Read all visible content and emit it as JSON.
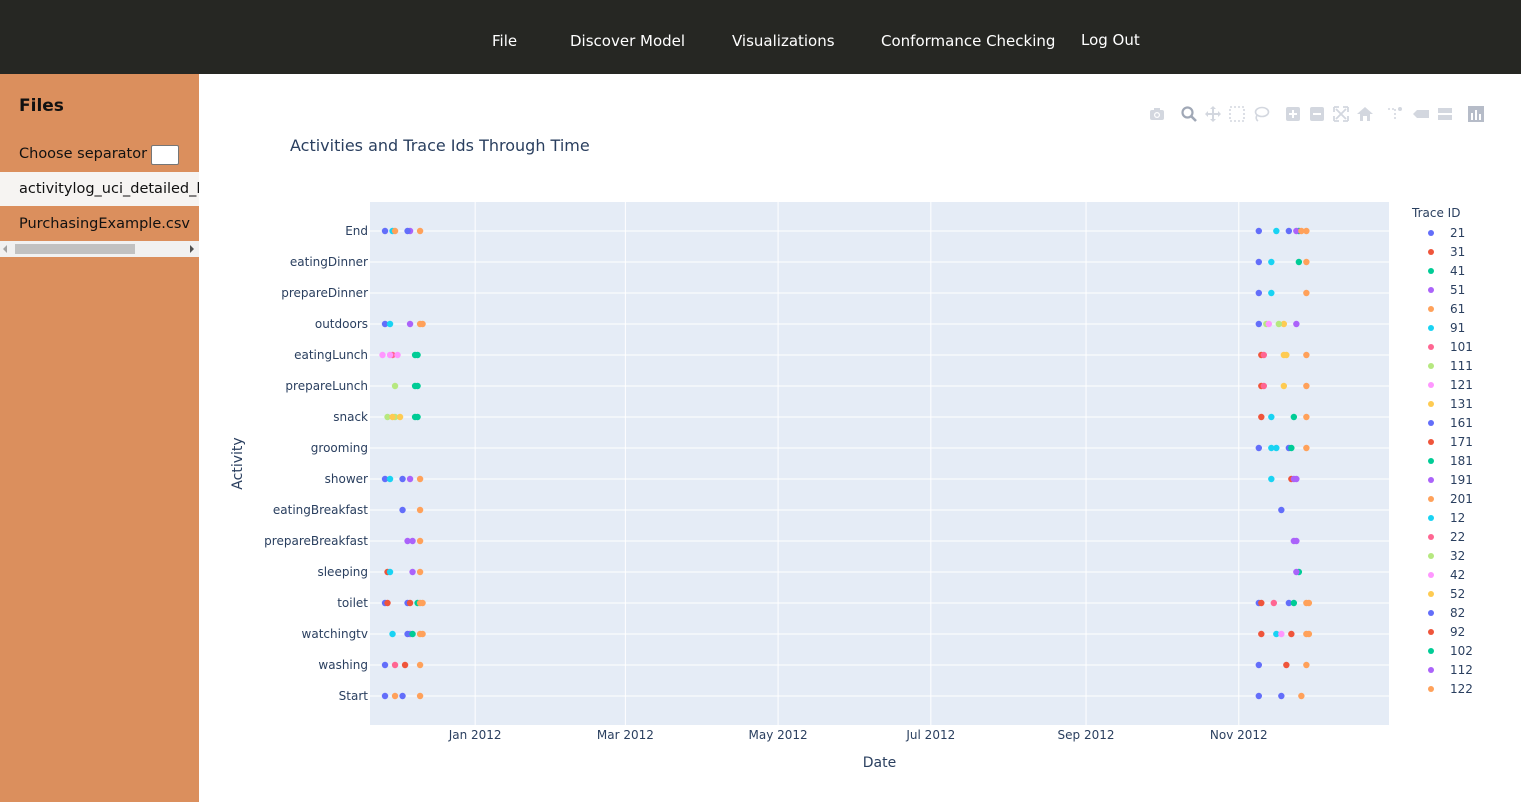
{
  "nav": {
    "items": [
      "File",
      "Discover Model",
      "Visualizations",
      "Conformance Checking",
      "Log Out"
    ]
  },
  "sidebar": {
    "title": "Files",
    "separator_label": "Choose separator",
    "separator_value": "",
    "files": [
      "activitylog_uci_detailed_labour.csv",
      "PurchasingExample.csv"
    ],
    "selected_file_index": 0
  },
  "colors": {
    "nav_bg": "#262723",
    "sidebar_bg": "#db8f5d",
    "plot_bg": "#e5ecf6",
    "text": "#2a3f5f"
  },
  "modebar": {
    "icons": [
      "camera-icon",
      "zoom-icon",
      "pan-icon",
      "box-select-icon",
      "lasso-icon",
      "zoom-in-icon",
      "zoom-out-icon",
      "autoscale-icon",
      "reset-axes-icon",
      "spike-lines-icon",
      "hover-closest-icon",
      "hover-compare-icon",
      "plotly-logo-icon"
    ]
  },
  "chart_data": {
    "type": "scatter",
    "title": "Activities and Trace Ids Through Time",
    "xlabel": "Date",
    "ylabel": "Activity",
    "x_ticks": [
      "Jan 2012",
      "Mar 2012",
      "May 2012",
      "Jul 2012",
      "Sep 2012",
      "Nov 2012"
    ],
    "x_tick_dates": [
      "2012-01-01",
      "2012-03-01",
      "2012-05-01",
      "2012-07-01",
      "2012-09-01",
      "2012-11-01"
    ],
    "xlim": [
      "2011-11-20",
      "2012-12-31"
    ],
    "categories": [
      "Start",
      "washing",
      "watchingtv",
      "toilet",
      "sleeping",
      "prepareBreakfast",
      "eatingBreakfast",
      "shower",
      "grooming",
      "snack",
      "prepareLunch",
      "eatingLunch",
      "outdoors",
      "prepareDinner",
      "eatingDinner",
      "End"
    ],
    "grid": true,
    "legend": {
      "title": "Trace ID",
      "placement": "right"
    },
    "series": [
      {
        "name": "21",
        "color": "#636efa",
        "points": [
          [
            "2011-11-26",
            "End"
          ],
          [
            "2011-11-26",
            "outdoors"
          ],
          [
            "2011-11-26",
            "shower"
          ],
          [
            "2011-11-26",
            "toilet"
          ],
          [
            "2011-11-26",
            "washing"
          ],
          [
            "2011-11-26",
            "Start"
          ],
          [
            "2012-11-09",
            "End"
          ],
          [
            "2012-11-09",
            "eatingDinner"
          ],
          [
            "2012-11-09",
            "prepareDinner"
          ],
          [
            "2012-11-09",
            "outdoors"
          ],
          [
            "2012-11-09",
            "grooming"
          ],
          [
            "2012-11-09",
            "toilet"
          ],
          [
            "2012-11-09",
            "washing"
          ],
          [
            "2012-11-09",
            "Start"
          ]
        ]
      },
      {
        "name": "31",
        "color": "#ef553b",
        "points": [
          [
            "2011-11-27",
            "toilet"
          ],
          [
            "2011-11-27",
            "sleeping"
          ],
          [
            "2012-11-10",
            "eatingLunch"
          ],
          [
            "2012-11-10",
            "prepareLunch"
          ],
          [
            "2012-11-10",
            "snack"
          ],
          [
            "2012-11-10",
            "toilet"
          ],
          [
            "2012-11-10",
            "watchingtv"
          ]
        ]
      },
      {
        "name": "41",
        "color": "#00cc96",
        "points": [
          [
            "2011-12-09",
            "eatingLunch"
          ],
          [
            "2011-12-09",
            "prepareLunch"
          ],
          [
            "2011-12-09",
            "snack"
          ],
          [
            "2011-12-09",
            "toilet"
          ],
          [
            "2012-11-25",
            "eatingDinner"
          ],
          [
            "2012-11-25",
            "End"
          ],
          [
            "2012-11-25",
            "sleeping"
          ]
        ]
      },
      {
        "name": "51",
        "color": "#ab63fa",
        "points": [
          [
            "2011-12-06",
            "End"
          ],
          [
            "2011-12-06",
            "outdoors"
          ],
          [
            "2011-12-06",
            "shower"
          ],
          [
            "2011-12-06",
            "watchingtv"
          ],
          [
            "2012-11-24",
            "outdoors"
          ],
          [
            "2012-11-24",
            "shower"
          ],
          [
            "2012-11-24",
            "sleeping"
          ],
          [
            "2012-11-24",
            "End"
          ]
        ]
      },
      {
        "name": "61",
        "color": "#ffa15a",
        "points": [
          [
            "2011-12-10",
            "End"
          ],
          [
            "2011-12-10",
            "outdoors"
          ],
          [
            "2011-12-10",
            "shower"
          ],
          [
            "2011-12-10",
            "eatingBreakfast"
          ],
          [
            "2011-12-10",
            "prepareBreakfast"
          ],
          [
            "2011-12-10",
            "sleeping"
          ],
          [
            "2011-12-10",
            "toilet"
          ],
          [
            "2011-12-10",
            "watchingtv"
          ],
          [
            "2011-12-10",
            "washing"
          ],
          [
            "2011-12-10",
            "Start"
          ],
          [
            "2012-11-28",
            "End"
          ],
          [
            "2012-11-28",
            "eatingDinner"
          ],
          [
            "2012-11-28",
            "prepareDinner"
          ],
          [
            "2012-11-28",
            "eatingLunch"
          ],
          [
            "2012-11-28",
            "prepareLunch"
          ],
          [
            "2012-11-28",
            "snack"
          ],
          [
            "2012-11-28",
            "grooming"
          ],
          [
            "2012-11-28",
            "watchingtv"
          ],
          [
            "2012-11-28",
            "toilet"
          ],
          [
            "2012-11-28",
            "washing"
          ]
        ]
      },
      {
        "name": "91",
        "color": "#19d3f3",
        "points": [
          [
            "2011-11-28",
            "outdoors"
          ],
          [
            "2011-11-28",
            "shower"
          ],
          [
            "2011-11-28",
            "sleeping"
          ],
          [
            "2012-11-14",
            "eatingDinner"
          ],
          [
            "2012-11-14",
            "prepareDinner"
          ],
          [
            "2012-11-14",
            "shower"
          ],
          [
            "2012-11-14",
            "grooming"
          ],
          [
            "2012-11-14",
            "snack"
          ]
        ]
      },
      {
        "name": "101",
        "color": "#ff6692",
        "points": [
          [
            "2011-11-29",
            "eatingLunch"
          ],
          [
            "2012-11-11",
            "eatingLunch"
          ],
          [
            "2012-11-11",
            "prepareLunch"
          ]
        ]
      },
      {
        "name": "111",
        "color": "#b6e880",
        "points": [
          [
            "2011-11-30",
            "snack"
          ],
          [
            "2011-11-30",
            "prepareLunch"
          ],
          [
            "2012-11-12",
            "outdoors"
          ]
        ]
      },
      {
        "name": "121",
        "color": "#ff97ff",
        "points": [
          [
            "2011-11-28",
            "eatingLunch"
          ],
          [
            "2011-12-01",
            "eatingLunch"
          ],
          [
            "2012-11-13",
            "outdoors"
          ]
        ]
      },
      {
        "name": "131",
        "color": "#fecb52",
        "points": [
          [
            "2011-12-02",
            "snack"
          ],
          [
            "2012-11-19",
            "eatingLunch"
          ],
          [
            "2012-11-19",
            "prepareLunch"
          ],
          [
            "2012-11-19",
            "outdoors"
          ]
        ]
      },
      {
        "name": "161",
        "color": "#636efa",
        "points": [
          [
            "2011-12-05",
            "End"
          ],
          [
            "2011-12-05",
            "watchingtv"
          ],
          [
            "2011-12-05",
            "toilet"
          ],
          [
            "2012-11-21",
            "End"
          ],
          [
            "2012-11-21",
            "grooming"
          ],
          [
            "2012-11-21",
            "toilet"
          ]
        ]
      },
      {
        "name": "171",
        "color": "#ef553b",
        "points": [
          [
            "2011-12-06",
            "toilet"
          ],
          [
            "2012-11-22",
            "shower"
          ],
          [
            "2012-11-22",
            "watchingtv"
          ]
        ]
      },
      {
        "name": "181",
        "color": "#00cc96",
        "points": [
          [
            "2011-12-08",
            "snack"
          ],
          [
            "2011-12-08",
            "prepareLunch"
          ],
          [
            "2011-12-08",
            "eatingLunch"
          ],
          [
            "2012-11-23",
            "snack"
          ],
          [
            "2012-11-23",
            "toilet"
          ]
        ]
      },
      {
        "name": "191",
        "color": "#ab63fa",
        "points": [
          [
            "2011-12-07",
            "sleeping"
          ],
          [
            "2011-12-07",
            "prepareBreakfast"
          ],
          [
            "2012-11-23",
            "shower"
          ],
          [
            "2012-11-23",
            "prepareBreakfast"
          ]
        ]
      },
      {
        "name": "201",
        "color": "#ffa15a",
        "points": [
          [
            "2011-12-11",
            "outdoors"
          ],
          [
            "2011-12-11",
            "toilet"
          ],
          [
            "2011-12-11",
            "watchingtv"
          ],
          [
            "2012-11-29",
            "watchingtv"
          ],
          [
            "2012-11-29",
            "toilet"
          ]
        ]
      },
      {
        "name": "12",
        "color": "#19d3f3",
        "points": [
          [
            "2011-11-29",
            "End"
          ],
          [
            "2011-11-29",
            "watchingtv"
          ],
          [
            "2012-11-16",
            "End"
          ],
          [
            "2012-11-16",
            "grooming"
          ],
          [
            "2012-11-16",
            "watchingtv"
          ]
        ]
      },
      {
        "name": "22",
        "color": "#ff6692",
        "points": [
          [
            "2011-11-30",
            "washing"
          ],
          [
            "2012-11-15",
            "toilet"
          ]
        ]
      },
      {
        "name": "32",
        "color": "#b6e880",
        "points": [
          [
            "2011-11-27",
            "snack"
          ],
          [
            "2012-11-17",
            "outdoors"
          ]
        ]
      },
      {
        "name": "42",
        "color": "#ff97ff",
        "points": [
          [
            "2011-11-25",
            "eatingLunch"
          ],
          [
            "2012-11-18",
            "watchingtv"
          ]
        ]
      },
      {
        "name": "52",
        "color": "#fecb52",
        "points": [
          [
            "2011-11-29",
            "snack"
          ],
          [
            "2012-11-20",
            "eatingLunch"
          ]
        ]
      },
      {
        "name": "82",
        "color": "#636efa",
        "points": [
          [
            "2011-12-03",
            "shower"
          ],
          [
            "2011-12-03",
            "eatingBreakfast"
          ],
          [
            "2011-12-03",
            "Start"
          ],
          [
            "2012-11-18",
            "eatingBreakfast"
          ],
          [
            "2012-11-18",
            "Start"
          ]
        ]
      },
      {
        "name": "92",
        "color": "#ef553b",
        "points": [
          [
            "2011-12-04",
            "washing"
          ],
          [
            "2012-11-20",
            "washing"
          ]
        ]
      },
      {
        "name": "102",
        "color": "#00cc96",
        "points": [
          [
            "2011-12-07",
            "watchingtv"
          ],
          [
            "2012-11-22",
            "grooming"
          ]
        ]
      },
      {
        "name": "112",
        "color": "#ab63fa",
        "points": [
          [
            "2011-12-05",
            "prepareBreakfast"
          ],
          [
            "2012-11-24",
            "prepareBreakfast"
          ]
        ]
      },
      {
        "name": "122",
        "color": "#ffa15a",
        "points": [
          [
            "2011-11-30",
            "End"
          ],
          [
            "2011-11-30",
            "Start"
          ],
          [
            "2012-11-26",
            "Start"
          ],
          [
            "2012-11-26",
            "End"
          ]
        ]
      }
    ]
  }
}
